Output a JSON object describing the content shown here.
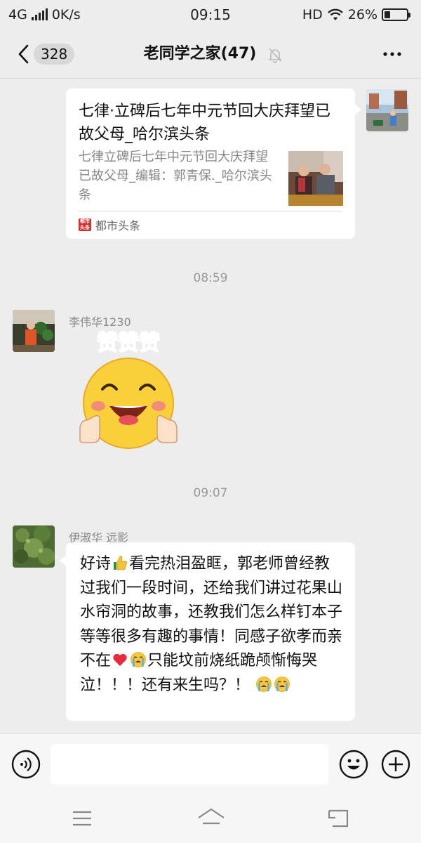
{
  "status_bar": {
    "network": "4G",
    "speed": "0K/s",
    "time": "09:15",
    "hd": "HD",
    "battery": "26%",
    "battery_level": 0.26
  },
  "nav": {
    "unread_count": "328",
    "title": "老同学之家(47)",
    "icons": [
      "back-icon",
      "mute-icon",
      "more-icon"
    ]
  },
  "messages": [
    {
      "type": "link_card",
      "direction": "outgoing",
      "title": "七律·立碑后七年中元节回大庆拜望已故父母_哈尔滨头条",
      "description": "七律立碑后七年中元节回大庆拜望已故父母_编辑：郭青保._哈尔滨头条",
      "source_logo": "都市头条",
      "source": "都市头条"
    },
    {
      "type": "timestamp",
      "text": "08:59"
    },
    {
      "type": "sticker",
      "direction": "incoming",
      "sender": "李伟华1230",
      "sticker_text": "赞赞赞"
    },
    {
      "type": "timestamp",
      "text": "09:07"
    },
    {
      "type": "text",
      "direction": "incoming",
      "sender": "伊淑华   远影",
      "seg1": "好诗",
      "seg2": "看完热泪盈眶，郭老师曾经教过我们一段时间，还给我们讲过花果山水帘洞的故事，还教我们怎么样钉本子等等很多有趣的事情！同感子欲孝而亲不在",
      "seg3": "只能坟前烧纸跪颅惭悔哭泣！！！还有来生吗？！ ",
      "emojis": [
        "thumbs-up",
        "red-heart",
        "loudly-crying",
        "loudly-crying",
        "loudly-crying"
      ]
    }
  ],
  "input_bar": {
    "placeholder": "",
    "icons": [
      "voice-icon",
      "emoji-icon",
      "plus-icon"
    ]
  },
  "android_nav": {
    "icons": [
      "menu-icon",
      "home-icon",
      "back-icon"
    ]
  },
  "colors": {
    "background": "#ededed",
    "bubble": "#ffffff",
    "meta_text": "#999999",
    "source_logo": "#d92b2b"
  }
}
